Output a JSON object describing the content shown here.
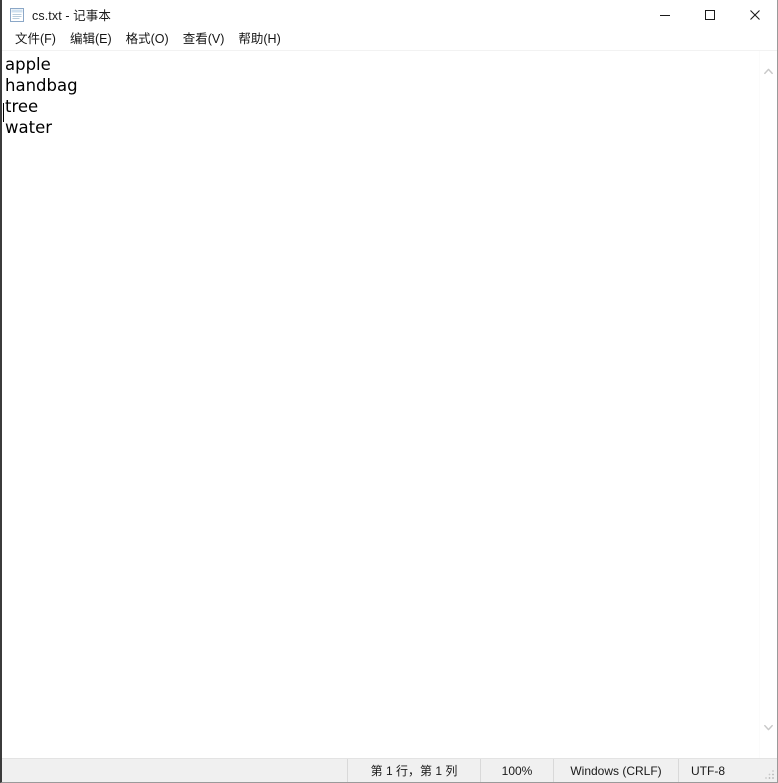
{
  "window": {
    "title": "cs.txt - 记事本",
    "icon": "notepad-document-icon",
    "controls": {
      "minimize_label": "最小化",
      "maximize_label": "最大化",
      "close_label": "关闭"
    }
  },
  "menubar": {
    "items": [
      {
        "label": "文件(F)",
        "name": "menu-file"
      },
      {
        "label": "编辑(E)",
        "name": "menu-edit"
      },
      {
        "label": "格式(O)",
        "name": "menu-format"
      },
      {
        "label": "查看(V)",
        "name": "menu-view"
      },
      {
        "label": "帮助(H)",
        "name": "menu-help"
      }
    ]
  },
  "editor": {
    "lines": [
      "apple",
      "handbag",
      "tree",
      "water"
    ],
    "caret_line": 1,
    "caret_column": 1
  },
  "scrollbar": {
    "up_icon": "chevron-up-icon",
    "down_icon": "chevron-down-icon"
  },
  "statusbar": {
    "position": "第 1 行，第 1 列",
    "zoom": "100%",
    "line_ending": "Windows (CRLF)",
    "encoding": "UTF-8"
  },
  "colors": {
    "window_bg": "#ffffff",
    "statusbar_bg": "#f0f0f0",
    "text": "#000000",
    "border": "#9a9a9a",
    "close_hover": "#e81123"
  }
}
